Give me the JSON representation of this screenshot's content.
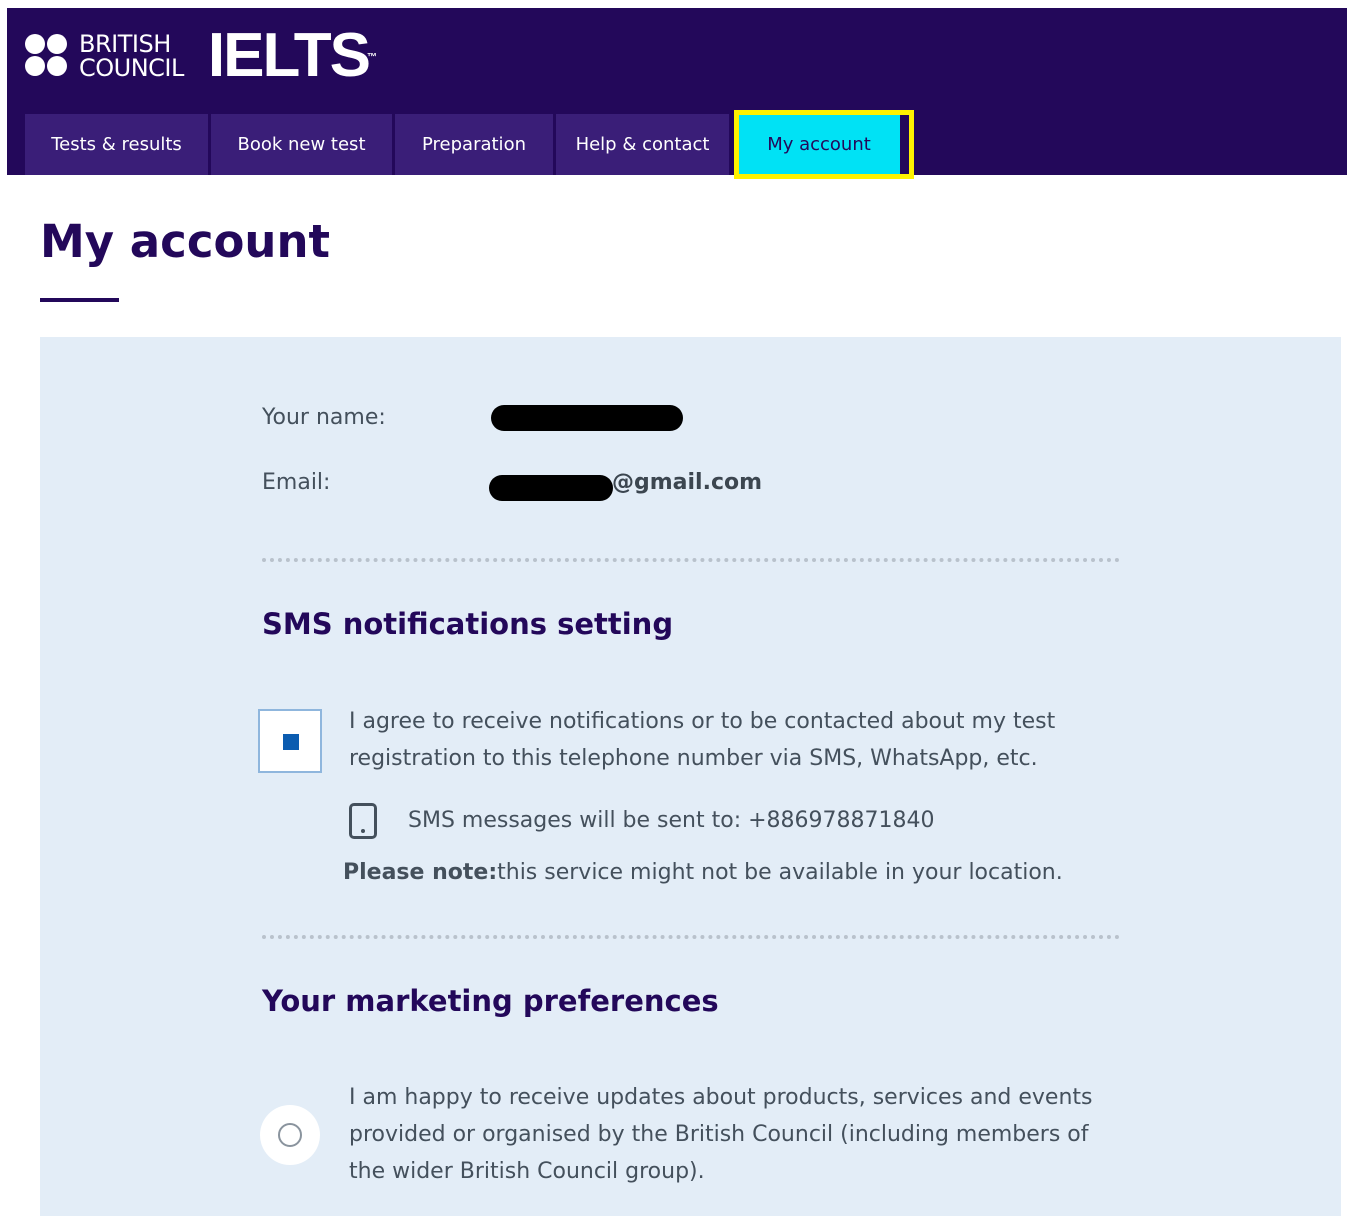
{
  "brand": {
    "org_line1": "BRITISH",
    "org_line2": "COUNCIL",
    "product": "IELTS",
    "trademark": "™"
  },
  "nav": {
    "tabs": [
      {
        "label": "Tests & results"
      },
      {
        "label": "Book new test"
      },
      {
        "label": "Preparation"
      },
      {
        "label": "Help & contact"
      },
      {
        "label": "My account",
        "active": true
      }
    ]
  },
  "page": {
    "title": "My account"
  },
  "account": {
    "name_label": "Your name:",
    "email_label": "Email:",
    "email_visible_suffix": "@gmail.com"
  },
  "sms": {
    "heading": "SMS notifications setting",
    "consent_text_line1": "I agree to receive notifications or to be contacted about my test",
    "consent_text_line2": "registration to this telephone number via SMS, WhatsApp, etc.",
    "checked": true,
    "sent_to_label": "SMS messages will be sent to:",
    "phone": "+886978871840",
    "note_label": "Please note:",
    "note_text": "this service might not be available in your location."
  },
  "marketing": {
    "heading": "Your marketing preferences",
    "text_line1": "I am happy to receive updates about products, services and events",
    "text_line2": "provided or organised by the British Council (including members of",
    "text_line3": "the wider British Council group).",
    "selected": false
  },
  "colors": {
    "brand_purple": "#23085a",
    "tab_bg": "#3a1e78",
    "active_tab": "#00e2f5",
    "highlight": "#fff200",
    "panel_bg": "#e3edf7",
    "checkbox_mark": "#0b5cb0"
  }
}
